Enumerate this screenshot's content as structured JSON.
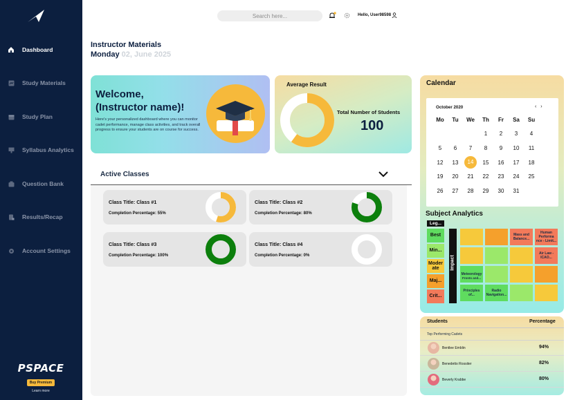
{
  "sidebar": {
    "items": [
      {
        "label": "Dashboard",
        "icon": "home-icon",
        "active": true
      },
      {
        "label": "Study Materials",
        "icon": "materials-icon"
      },
      {
        "label": "Study Plan",
        "icon": "calendar-icon"
      },
      {
        "label": "Syllabus Analytics",
        "icon": "analytics-icon"
      },
      {
        "label": "Question Bank",
        "icon": "bank-icon"
      },
      {
        "label": "Results/Recap",
        "icon": "results-icon"
      },
      {
        "label": "Account Settings",
        "icon": "gear-icon"
      }
    ],
    "brand": "PSPACE",
    "premium_label": "Buy Premium",
    "learn_more": "Learn more"
  },
  "header": {
    "search_placeholder": "Search here...",
    "greeting": "Hello, User98598"
  },
  "page": {
    "title": "Instructor Materials",
    "day": "Monday",
    "date": "02, June 2025"
  },
  "welcome": {
    "heading_line1": "Welcome,",
    "heading_line2": "(Instructor name)!",
    "text": "Here's your personalized dashboard where you can monitor cadet performance, manage class activities, and track overall progress to ensure your students are on course for success."
  },
  "average": {
    "title": "Average Result",
    "value_pct": 60,
    "total_label": "Total Number of Students",
    "total_value": "100",
    "colors": {
      "fill": "#f6b93b",
      "track": "#ffffff"
    }
  },
  "active_classes": {
    "title": "Active Classes",
    "classes": [
      {
        "title": "Class Title: Class #1",
        "completion": "Completion Percentage: 55%",
        "pct": 55,
        "color": "#f6b93b"
      },
      {
        "title": "Class Title: Class #2",
        "completion": "Completion Percentage: 80%",
        "pct": 80,
        "color": "#0c7f0c"
      },
      {
        "title": "Class Title: Class #3",
        "completion": "Completion Percentage: 100%",
        "pct": 100,
        "color": "#0c7f0c"
      },
      {
        "title": "Class Title: Class #4",
        "completion": "Completion Percentage: 0%",
        "pct": 0,
        "color": "#0c7f0c"
      }
    ]
  },
  "calendar": {
    "title": "Calendar",
    "month": "October 2020",
    "prev": "‹",
    "next": "›",
    "weekdays": [
      "Mo",
      "Tu",
      "We",
      "Th",
      "Fr",
      "Sa",
      "Su"
    ],
    "weeks": [
      [
        "",
        "",
        "",
        "1",
        "2",
        "3",
        "4"
      ],
      [
        "5",
        "6",
        "7",
        "8",
        "9",
        "10",
        "11"
      ],
      [
        "12",
        "13",
        "14",
        "15",
        "16",
        "17",
        "18"
      ],
      [
        "19",
        "20",
        "21",
        "22",
        "23",
        "24",
        "25"
      ],
      [
        "26",
        "27",
        "28",
        "29",
        "30",
        "31",
        ""
      ]
    ],
    "selected": "14",
    "accent": "#f6b93b"
  },
  "subject_analytics": {
    "title": "Subject Analytics",
    "legend_label": "Leg...",
    "legend": [
      {
        "label": "Best",
        "color": "#5fdc5f"
      },
      {
        "label": "Min...",
        "color": "#9be86a"
      },
      {
        "label": "Moder ate",
        "color": "#f6c93b"
      },
      {
        "label": "Maj...",
        "color": "#f5a02c"
      },
      {
        "label": "Crit...",
        "color": "#f37a5a"
      }
    ],
    "impact_label": "Impact",
    "cells": [
      {
        "label": "",
        "color": "#f6c93b"
      },
      {
        "label": "",
        "color": "#f5a02c"
      },
      {
        "label": "Mass and Balance...",
        "color": "#f37a5a"
      },
      {
        "label": "Human Performa nce - Limit...",
        "color": "#f37a5a"
      },
      {
        "label": "",
        "color": "#f6c93b"
      },
      {
        "label": "",
        "color": "#9be86a"
      },
      {
        "label": "",
        "color": "#f6c93b"
      },
      {
        "label": "Air Law - ICAO...",
        "color": "#f37a5a"
      },
      {
        "label": "Meteorology",
        "color": "#5fdc5f"
      },
      {
        "label": "",
        "color": "#9be86a"
      },
      {
        "label": "",
        "color": "#f6c93b"
      },
      {
        "label": "",
        "color": "#f5a02c"
      },
      {
        "label": "Principles of...",
        "color": "#5fdc5f"
      },
      {
        "label": "Radio Navigation...",
        "color": "#5fdc5f"
      },
      {
        "label": "",
        "color": "#9be86a"
      },
      {
        "label": "",
        "color": "#f6c93b"
      }
    ],
    "extra_label": "Fronts and..."
  },
  "students": {
    "col_students": "Students",
    "col_percentage": "Percentage",
    "subheading": "Top Performing Cadets",
    "rows": [
      {
        "name": "Bentlee Emblin",
        "pct": "94%",
        "avatar": "#e7b7a3"
      },
      {
        "name": "Benedetto Rossiter",
        "pct": "82%",
        "avatar": "#c9b79b"
      },
      {
        "name": "Beverly Krabbe",
        "pct": "80%",
        "avatar": "#e36b7d"
      }
    ]
  }
}
